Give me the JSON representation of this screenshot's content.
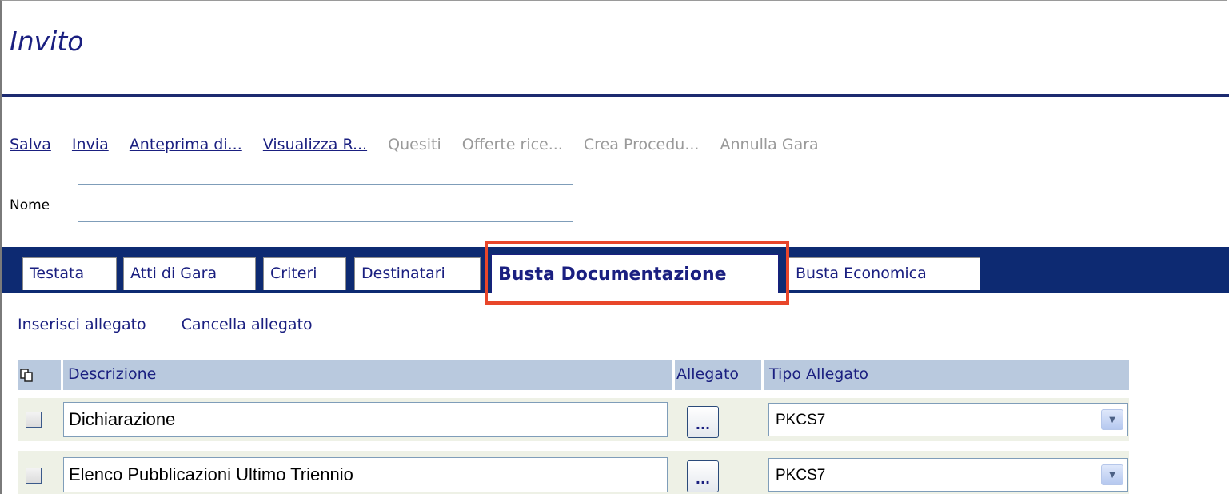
{
  "header": {
    "title": "Invito"
  },
  "toolbar": {
    "items": [
      {
        "label": "Salva",
        "enabled": true
      },
      {
        "label": "Invia",
        "enabled": true
      },
      {
        "label": "Anteprima di...",
        "enabled": true
      },
      {
        "label": "Visualizza R...",
        "enabled": true
      },
      {
        "label": "Quesiti",
        "enabled": false
      },
      {
        "label": "Offerte rice...",
        "enabled": false
      },
      {
        "label": "Crea Procedu...",
        "enabled": false
      },
      {
        "label": "Annulla Gara",
        "enabled": false
      }
    ]
  },
  "form": {
    "nome_label": "Nome",
    "nome_value": ""
  },
  "tabs": [
    {
      "label": "Testata"
    },
    {
      "label": "Atti di Gara"
    },
    {
      "label": "Criteri"
    },
    {
      "label": "Destinatari"
    },
    {
      "label": "Busta Documentazione",
      "selected": true
    },
    {
      "label": "Busta Economica"
    }
  ],
  "actions": {
    "insert_label": "Inserisci allegato",
    "delete_label": "Cancella allegato"
  },
  "table": {
    "columns": {
      "descrizione": "Descrizione",
      "allegato": "Allegato",
      "tipo_allegato": "Tipo Allegato"
    },
    "rows": [
      {
        "descrizione": "Dichiarazione",
        "allegato_button": "...",
        "tipo_allegato": "PKCS7",
        "checked": false
      },
      {
        "descrizione": "Elenco Pubblicazioni Ultimo Triennio",
        "allegato_button": "...",
        "tipo_allegato": "PKCS7",
        "checked": false
      }
    ]
  },
  "icons": {
    "copy": "copy-icon",
    "dropdown": "chevron-down-icon"
  },
  "colors": {
    "title": "#1a1f80",
    "tabbar": "#0d2a72",
    "highlight": "#e8462a",
    "header_row": "#b9c9de",
    "disabled_link": "#9a9a9a"
  }
}
